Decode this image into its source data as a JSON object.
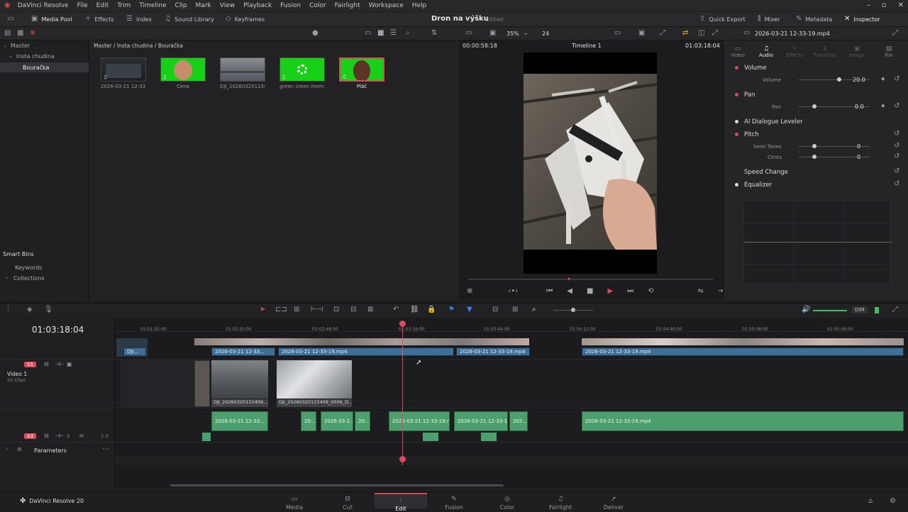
{
  "menubar": {
    "app": "DaVinci Resolve",
    "items": [
      "File",
      "Edit",
      "Trim",
      "Timeline",
      "Clip",
      "Mark",
      "View",
      "Playback",
      "Fusion",
      "Color",
      "Fairlight",
      "Workspace",
      "Help"
    ]
  },
  "toolbar": {
    "media_pool": "Media Pool",
    "effects": "Effects",
    "index": "Index",
    "sound_library": "Sound Library",
    "keyframes": "Keyframes",
    "project_title": "Dron na výšku",
    "project_status": "Edited",
    "quick_export": "Quick Export",
    "mixer": "Mixer",
    "metadata": "Metadata",
    "inspector": "Inspector"
  },
  "poolbar": {
    "zoom": "35%",
    "fps": "24",
    "clip_name": "2026-03-21 12-33-19.mp4"
  },
  "bins": {
    "master": "Master",
    "insta": "Insta chudina",
    "bouracka": "Bouračka",
    "smart_bins": "Smart Bins",
    "keywords": "Keywords",
    "collections": "Collections"
  },
  "mediapool": {
    "path": "Master / Insta chudina / Bouračka",
    "clips": [
      {
        "label": "2026-03-21 12-33..."
      },
      {
        "label": "Cena"
      },
      {
        "label": "DJI_202603201154..."
      },
      {
        "label": "green creen mem..."
      },
      {
        "label": "Pláč"
      }
    ]
  },
  "viewer": {
    "timecode_left": "00:00:58:18",
    "title": "Timeline 1",
    "timecode_right": "01:03:18:04"
  },
  "inspector": {
    "tabs": [
      "Video",
      "Audio",
      "Effects",
      "Transition",
      "Image",
      "File"
    ],
    "volume": "Volume",
    "volume_label": "Volume",
    "volume_value": "20.0",
    "pan": "Pan",
    "pan_label": "Pan",
    "pan_value": "0.0",
    "dialogue": "AI Dialogue Leveler",
    "pitch": "Pitch",
    "semitones_label": "Semi Tones",
    "semitones_value": "0",
    "cents_label": "Cents",
    "cents_value": "0",
    "speed": "Speed Change",
    "equalizer": "Equalizer"
  },
  "timeline": {
    "timecode": "01:03:18:04",
    "ruler": [
      "01:01:52:00",
      "01:02:20:00",
      "01:02:48:00",
      "01:03:16:00",
      "01:03:44:00",
      "01:04:12:00",
      "01:04:40:00",
      "01:05:08:00",
      "01:05:36:00"
    ],
    "v1_label": "V1",
    "video1_name": "Video 1",
    "video1_count": "20 Clips",
    "a3_label": "A3",
    "a3_level": "2.0",
    "parameters": "Parameters",
    "dim": "DIM",
    "v2clips": [
      "DJI...",
      "2026-03-21 12-33...",
      "2026-03-21 12-33-19.mp4",
      "2026-03-21 12-33-19.mp4",
      "2026-03-21 12-33-19.mp4"
    ],
    "v1clips": [
      "DJI_20260320115409...",
      "DJI_20260320115409_0006_D..."
    ],
    "aclips": [
      "2026-03-21 12-33...",
      "20...",
      "2026-03-2...",
      "20...",
      "2026-03-21 12-33-19.m...",
      "2026-03-21 12-33-1...",
      "202...",
      "2026-03-21 12-33-19.mp4"
    ]
  },
  "pages": {
    "brand": "DaVinci Resolve 20",
    "items": [
      "Media",
      "Cut",
      "Edit",
      "Fusion",
      "Color",
      "Fairlight",
      "Deliver"
    ],
    "active": "Edit"
  }
}
